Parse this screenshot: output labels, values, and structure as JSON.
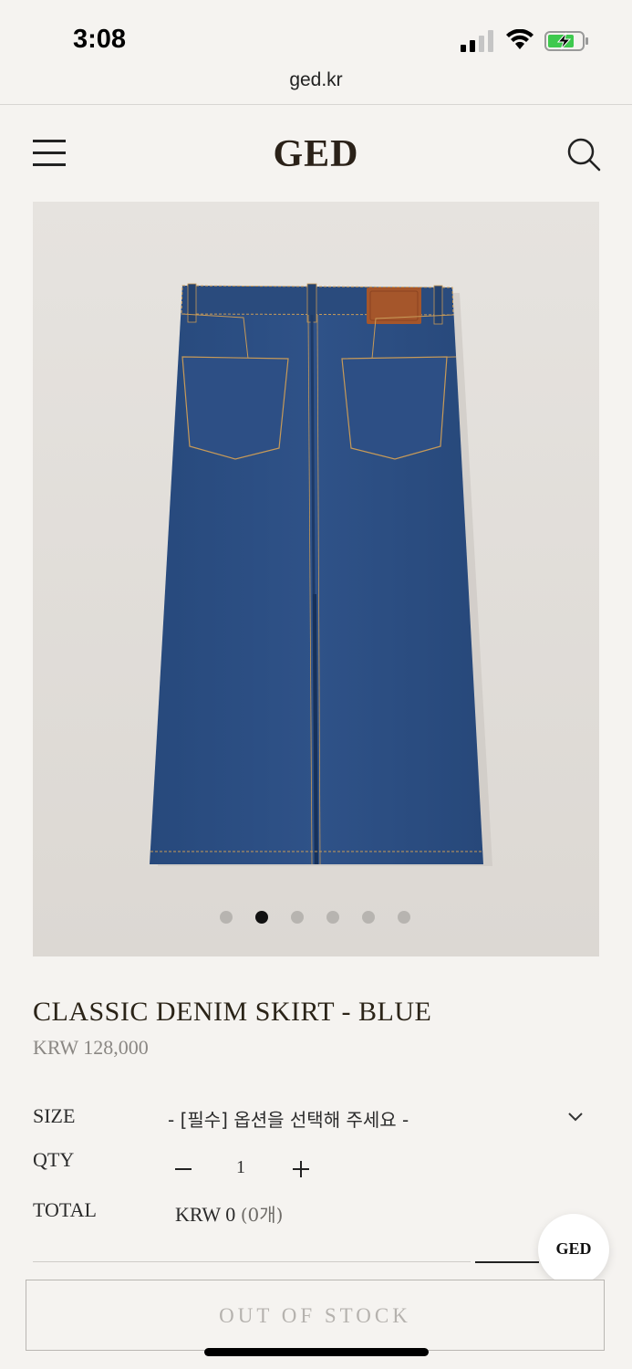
{
  "status_bar": {
    "time": "3:08"
  },
  "browser": {
    "url": "ged.kr"
  },
  "header": {
    "brand": "GED",
    "menu_icon": "hamburger-menu-icon",
    "search_icon": "search-icon"
  },
  "gallery": {
    "total_images": 6,
    "active_index": 1
  },
  "product": {
    "title": "CLASSIC DENIM SKIRT - BLUE",
    "price": "KRW 128,000"
  },
  "options": {
    "size_label": "SIZE",
    "size_placeholder": "- [필수] 옵션을 선택해 주세요 -",
    "qty_label": "QTY",
    "qty_minus": "−",
    "qty_value": "1",
    "qty_plus": "+",
    "total_label": "TOTAL",
    "total_value": "KRW 0",
    "total_count": "(0개)"
  },
  "chat_button": {
    "label": "GED"
  },
  "cta": {
    "label": "OUT OF STOCK"
  },
  "colors": {
    "background": "#f5f3f0",
    "denim": "#2f4f83",
    "leather_patch": "#a5562b",
    "disabled_text": "#b5b2ae"
  }
}
